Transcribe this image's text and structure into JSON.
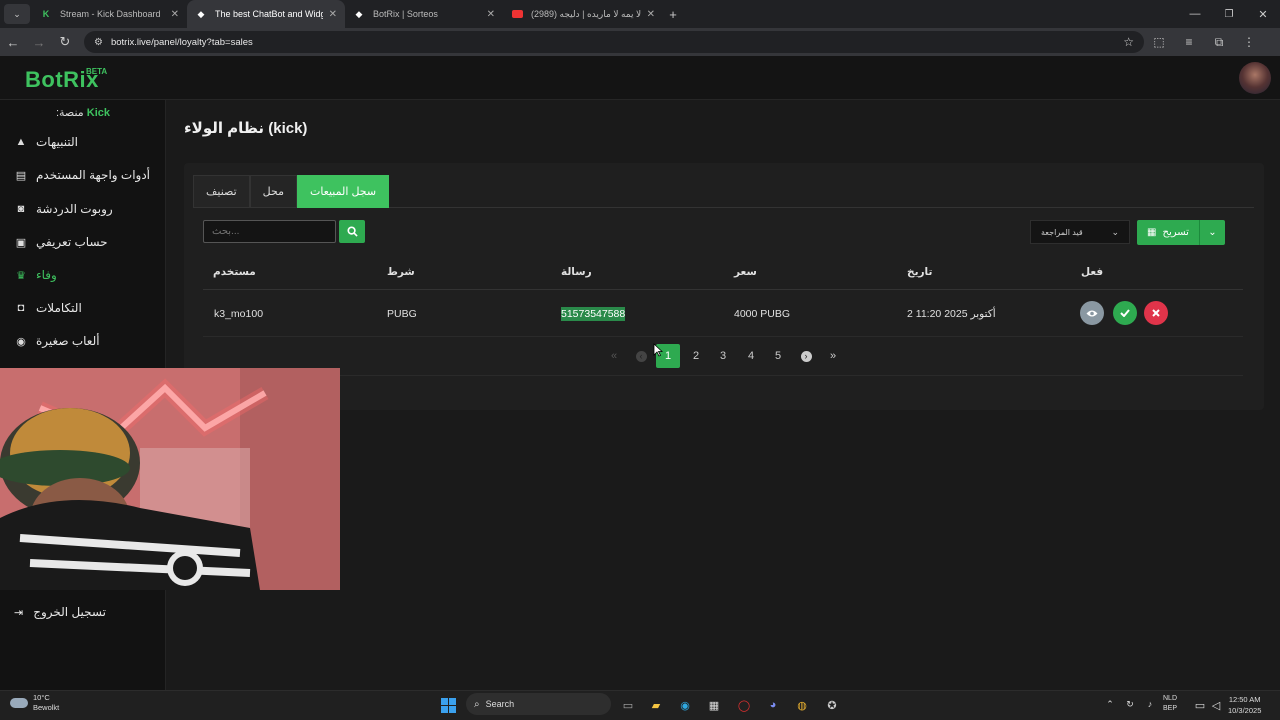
{
  "browser": {
    "tabs": [
      {
        "title": "Stream - Kick Dashboard",
        "icon": "kick-icon",
        "active": false
      },
      {
        "title": "The best ChatBot and Widgets",
        "icon": "botrix-icon",
        "active": true
      },
      {
        "title": "BotRix | Sorteos",
        "icon": "botrix-icon",
        "active": false
      },
      {
        "title": "(2989) لا يمه لا ماريده | دليجه ..",
        "icon": "youtube-icon",
        "active": false
      }
    ],
    "url": "botrix.live/panel/loyalty?tab=sales"
  },
  "app": {
    "logo": "BotRix",
    "beta": "BETA",
    "platform_label": "منصة:",
    "platform_value": "Kick"
  },
  "sidebar": {
    "items": [
      {
        "label": "التنبيهات",
        "icon": "warning-icon",
        "active": false
      },
      {
        "label": "أدوات واجهة المستخدم",
        "icon": "widgets-icon",
        "active": false
      },
      {
        "label": "روبوت الدردشة",
        "icon": "robot-icon",
        "active": false
      },
      {
        "label": "حساب تعريفي",
        "icon": "id-card-icon",
        "active": false
      },
      {
        "label": "وفاء",
        "icon": "trophy-icon",
        "active": true
      },
      {
        "label": "التكاملات",
        "icon": "integration-icon",
        "active": false
      },
      {
        "label": "ألعاب صغيرة",
        "icon": "gamepad-icon",
        "active": false
      }
    ],
    "logout": "تسجيل الخروج"
  },
  "page": {
    "title": "نظام الولاء (kick)",
    "tabs": [
      {
        "label": "سجل المبيعات",
        "active": true
      },
      {
        "label": "محل",
        "active": false
      },
      {
        "label": "تصنيف",
        "active": false
      }
    ],
    "export_label": "تسريح",
    "filter_label": "قيد المراجعة",
    "search_placeholder": "...بحث"
  },
  "table": {
    "headers": {
      "user": "مستخدم",
      "condition": "شرط",
      "message": "رسالة",
      "price": "سعر",
      "date": "تاريخ",
      "action": "فعل"
    },
    "rows": [
      {
        "user": "k3_mo100",
        "condition": "PUBG",
        "message": "51573547588",
        "price": "4000 PUBG",
        "date": "2 أكتوبر 2025 11:20"
      }
    ]
  },
  "pagination": {
    "pages": [
      "1",
      "2",
      "3",
      "4",
      "5"
    ],
    "current": "1",
    "first": "«",
    "prev": "‹",
    "next": "›",
    "last": "»"
  },
  "taskbar": {
    "weather_temp": "10°C",
    "weather_desc": "Bewolkt",
    "search": "Search",
    "lang_1": "NLD",
    "lang_2": "BEP",
    "time": "12:50 AM",
    "date": "10/3/2025"
  },
  "colors": {
    "accent": "#3ec25f",
    "danger": "#e0344a",
    "muted": "#8a98a2"
  }
}
